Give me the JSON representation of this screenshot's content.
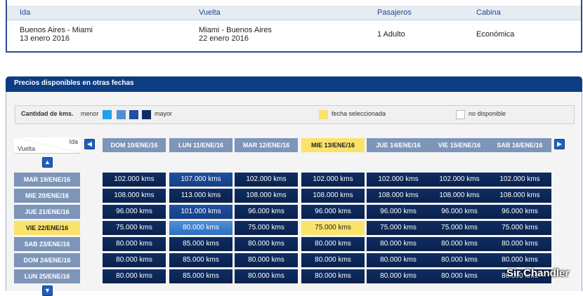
{
  "summary": {
    "headers": {
      "ida": "Ida",
      "vuelta": "Vuelta",
      "pasajeros": "Pasajeros",
      "cabina": "Cabina"
    },
    "ida_route": "Buenos Aires - Miami",
    "ida_date": "13 enero 2016",
    "vuelta_route": "Miami - Buenos Aires",
    "vuelta_date": "22 enero 2016",
    "pasajeros": "1 Adulto",
    "cabina": "Económica"
  },
  "panel": {
    "title": "Precios disponibles en otras fechas"
  },
  "legend": {
    "title": "Cantidad de kms.",
    "menor": "menor",
    "mayor": "mayor",
    "selected": "fecha seleccionada",
    "unavailable": "no disponible",
    "colors": [
      "#22a0ea",
      "#4f8fd8",
      "#1e4fa0",
      "#0e2d64"
    ],
    "selected_color": "#fae36b",
    "unavailable_color": "#ffffff"
  },
  "corner": {
    "ida": "Ida",
    "vuelta": "Vuelta"
  },
  "columns": [
    "DOM 10/ENE/16",
    "LUN 11/ENE/16",
    "MAR 12/ENE/16",
    "MIE 13/ENE/16",
    "JUE 14/ENE/16",
    "VIE 15/ENE/16",
    "SAB 16/ENE/16"
  ],
  "selected_column": 3,
  "rows": [
    {
      "label": "MAR 19/ENE/16",
      "cells": [
        "102.000 kms",
        "107.000 kms",
        "102.000 kms",
        "102.000 kms",
        "102.000 kms",
        "102.000 kms",
        "102.000 kms"
      ],
      "levels": [
        3,
        2,
        3,
        3,
        3,
        3,
        3
      ]
    },
    {
      "label": "MIE 20/ENE/16",
      "cells": [
        "108.000 kms",
        "113.000 kms",
        "108.000 kms",
        "108.000 kms",
        "108.000 kms",
        "108.000 kms",
        "108.000 kms"
      ],
      "levels": [
        3,
        3,
        3,
        3,
        3,
        3,
        3
      ]
    },
    {
      "label": "JUE 21/ENE/16",
      "cells": [
        "96.000 kms",
        "101.000 kms",
        "96.000 kms",
        "96.000 kms",
        "96.000 kms",
        "96.000 kms",
        "96.000 kms"
      ],
      "levels": [
        3,
        2,
        3,
        3,
        3,
        3,
        3
      ]
    },
    {
      "label": "VIE 22/ENE/16",
      "cells": [
        "75.000 kms",
        "80.000 kms",
        "75.000 kms",
        "75.000 kms",
        "75.000 kms",
        "75.000 kms",
        "75.000 kms"
      ],
      "levels": [
        3,
        1,
        3,
        4,
        3,
        3,
        3
      ]
    },
    {
      "label": "SAB 23/ENE/16",
      "cells": [
        "80.000 kms",
        "85.000 kms",
        "80.000 kms",
        "80.000 kms",
        "80.000 kms",
        "80.000 kms",
        "80.000 kms"
      ],
      "levels": [
        3,
        3,
        3,
        3,
        3,
        3,
        3
      ]
    },
    {
      "label": "DOM 24/ENE/16",
      "cells": [
        "80.000 kms",
        "85.000 kms",
        "80.000 kms",
        "80.000 kms",
        "80.000 kms",
        "80.000 kms",
        "80.000 kms"
      ],
      "levels": [
        3,
        3,
        3,
        3,
        3,
        3,
        3
      ]
    },
    {
      "label": "LUN 25/ENE/16",
      "cells": [
        "80.000 kms",
        "85.000 kms",
        "80.000 kms",
        "80.000 kms",
        "80.000 kms",
        "80.000 kms",
        "80.000 kms"
      ],
      "levels": [
        3,
        3,
        3,
        3,
        3,
        3,
        3
      ]
    }
  ],
  "selected_row": 3,
  "icons": {
    "prev": "chevron-left-icon",
    "next": "chevron-right-icon",
    "up": "chevron-up-icon",
    "down": "chevron-down-icon"
  },
  "watermark": "Sir Chandler"
}
